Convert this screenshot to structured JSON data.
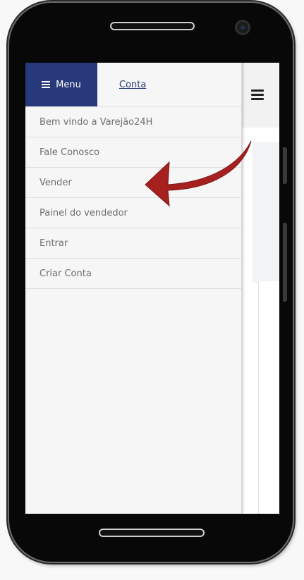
{
  "drawer": {
    "tabs": {
      "menu_label": "Menu",
      "account_label": "Conta"
    },
    "items": [
      {
        "label": "Bem vindo a Varejão24H"
      },
      {
        "label": "Fale Conosco"
      },
      {
        "label": "Vender"
      },
      {
        "label": "Painel do vendedor"
      },
      {
        "label": "Entrar"
      },
      {
        "label": "Criar Conta"
      }
    ]
  },
  "icons": {
    "menu_tab": "hamburger-icon",
    "page_toggle": "hamburger-icon",
    "annotation": "arrow-icon"
  },
  "colors": {
    "menu_tab_bg": "#27397a",
    "account_link": "#27397a",
    "arrow": "#a6201f",
    "phone_body": "#080808"
  }
}
